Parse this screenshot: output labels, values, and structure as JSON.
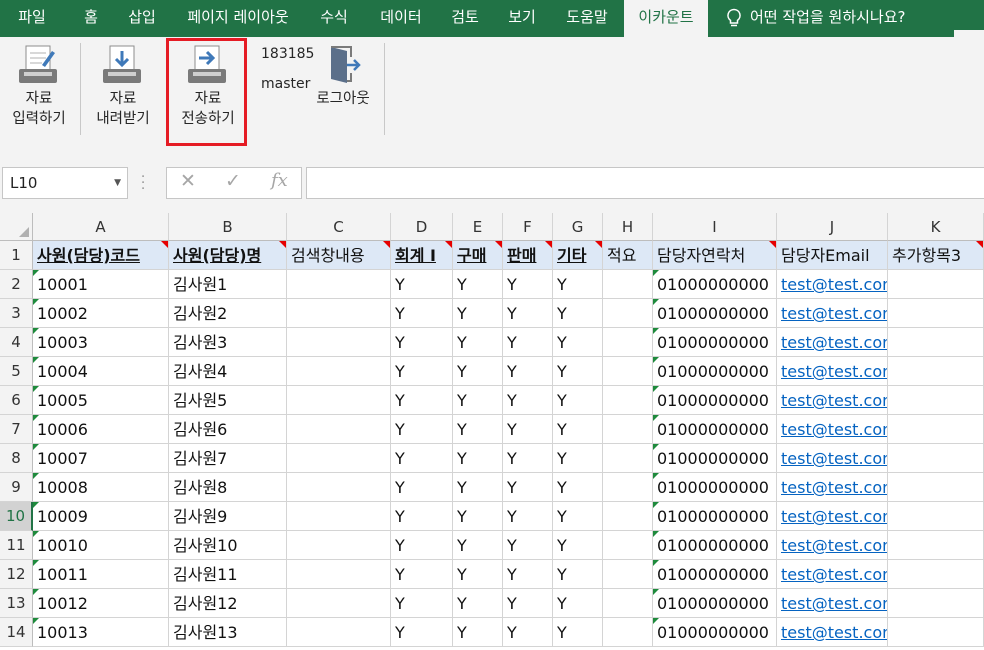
{
  "ribbon_tabs": [
    "파일",
    "홈",
    "삽입",
    "페이지 레이아웃",
    "수식",
    "데이터",
    "검토",
    "보기",
    "도움말",
    "이카운트"
  ],
  "active_tab": "이카운트",
  "tell_me": "어떤 작업을 원하시나요?",
  "ribbon_buttons": {
    "input_label_1": "자료",
    "input_label_2": "입력하기",
    "download_label_1": "자료",
    "download_label_2": "내려받기",
    "send_label_1": "자료",
    "send_label_2": "전송하기",
    "logout_label": "로그아웃"
  },
  "user": {
    "code": "183185",
    "name": "master"
  },
  "name_box": "L10",
  "formula_value": "",
  "columns": [
    "A",
    "B",
    "C",
    "D",
    "E",
    "F",
    "G",
    "H",
    "I",
    "J",
    "K"
  ],
  "header_row": [
    "사원(담당)코드",
    "사원(담당)명",
    "검색창내용",
    "회계 I",
    "구매",
    "판매",
    "기타",
    "적요",
    "담당자연락처",
    "담당자Email",
    "추가항목3"
  ],
  "rows": [
    [
      "10001",
      "김사원1",
      "",
      "Y",
      "Y",
      "Y",
      "Y",
      "",
      "01000000000",
      "test@test.com",
      ""
    ],
    [
      "10002",
      "김사원2",
      "",
      "Y",
      "Y",
      "Y",
      "Y",
      "",
      "01000000000",
      "test@test.com",
      ""
    ],
    [
      "10003",
      "김사원3",
      "",
      "Y",
      "Y",
      "Y",
      "Y",
      "",
      "01000000000",
      "test@test.com",
      ""
    ],
    [
      "10004",
      "김사원4",
      "",
      "Y",
      "Y",
      "Y",
      "Y",
      "",
      "01000000000",
      "test@test.com",
      ""
    ],
    [
      "10005",
      "김사원5",
      "",
      "Y",
      "Y",
      "Y",
      "Y",
      "",
      "01000000000",
      "test@test.com",
      ""
    ],
    [
      "10006",
      "김사원6",
      "",
      "Y",
      "Y",
      "Y",
      "Y",
      "",
      "01000000000",
      "test@test.com",
      ""
    ],
    [
      "10007",
      "김사원7",
      "",
      "Y",
      "Y",
      "Y",
      "Y",
      "",
      "01000000000",
      "test@test.com",
      ""
    ],
    [
      "10008",
      "김사원8",
      "",
      "Y",
      "Y",
      "Y",
      "Y",
      "",
      "01000000000",
      "test@test.com",
      ""
    ],
    [
      "10009",
      "김사원9",
      "",
      "Y",
      "Y",
      "Y",
      "Y",
      "",
      "01000000000",
      "test@test.com",
      ""
    ],
    [
      "10010",
      "김사원10",
      "",
      "Y",
      "Y",
      "Y",
      "Y",
      "",
      "01000000000",
      "test@test.com",
      ""
    ],
    [
      "10011",
      "김사원11",
      "",
      "Y",
      "Y",
      "Y",
      "Y",
      "",
      "01000000000",
      "test@test.com",
      ""
    ],
    [
      "10012",
      "김사원12",
      "",
      "Y",
      "Y",
      "Y",
      "Y",
      "",
      "01000000000",
      "test@test.com",
      ""
    ],
    [
      "10013",
      "김사원13",
      "",
      "Y",
      "Y",
      "Y",
      "Y",
      "",
      "01000000000",
      "test@test.com",
      ""
    ]
  ],
  "row_numbers": [
    "1",
    "2",
    "3",
    "4",
    "5",
    "6",
    "7",
    "8",
    "9",
    "10",
    "11",
    "12",
    "13",
    "14"
  ],
  "selected_row": "10",
  "colors": {
    "accent": "#217346",
    "highlight": "#e51b24",
    "link": "#0563c1",
    "header_fill": "#dde8f6"
  }
}
